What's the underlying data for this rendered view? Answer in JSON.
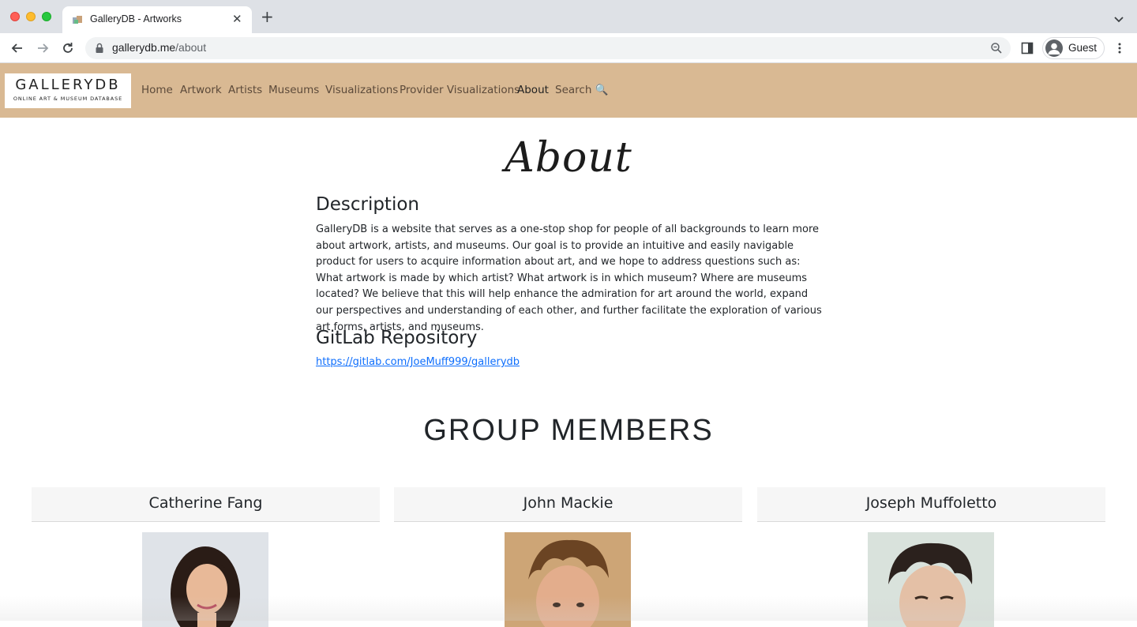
{
  "browser": {
    "tab_title": "GalleryDB - Artworks",
    "url_host": "gallerydb.me",
    "url_path": "/about",
    "profile_label": "Guest"
  },
  "site": {
    "logo_title": "GALLERYDB",
    "logo_subtitle": "ONLINE ART & MUSEUM DATABASE",
    "nav": [
      {
        "label": "Home"
      },
      {
        "label": "Artwork"
      },
      {
        "label": "Artists"
      },
      {
        "label": "Museums"
      },
      {
        "label": "Visualizations"
      },
      {
        "label": "Provider Visualizations"
      },
      {
        "label": "About",
        "active": true
      },
      {
        "label": "Search 🔍"
      }
    ]
  },
  "page": {
    "title": "About",
    "description_heading": "Description",
    "description_text": "GalleryDB is a website that serves as a one-stop shop for people of all backgrounds to learn more about artwork, artists, and museums. Our goal is to provide an intuitive and easily navigable product for users to acquire information about art, and we hope to address questions such as: What artwork is made by which artist? What artwork is in which museum? Where are museums located? We believe that this will help enhance the admiration for art around the world, expand our perspectives and understanding of each other, and further facilitate the exploration of various art forms, artists, and museums.",
    "repo_heading": "GitLab Repository",
    "repo_link": "https://gitlab.com/JoeMuff999/gallerydb",
    "members_heading": "GROUP MEMBERS",
    "members": [
      {
        "name": "Catherine Fang"
      },
      {
        "name": "John Mackie"
      },
      {
        "name": "Joseph Muffoletto"
      }
    ]
  },
  "colors": {
    "navbar_bg": "#d9b993",
    "link": "#0d6efd",
    "card_header_bg": "#f6f6f6"
  }
}
